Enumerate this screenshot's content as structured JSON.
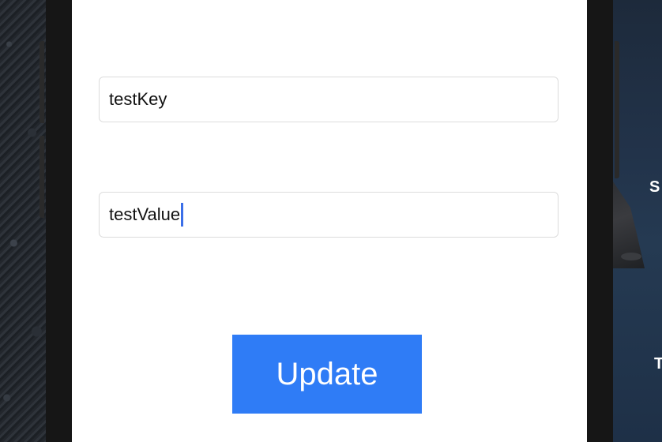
{
  "form": {
    "key_value": "testKey",
    "value_value": "testValue",
    "update_label": "Update"
  },
  "desktop": {
    "right_labels": [
      "S",
      "T"
    ]
  },
  "colors": {
    "accent": "#2f7cf6",
    "caret": "#3b6fe8",
    "field_border": "#dcdcdc"
  }
}
